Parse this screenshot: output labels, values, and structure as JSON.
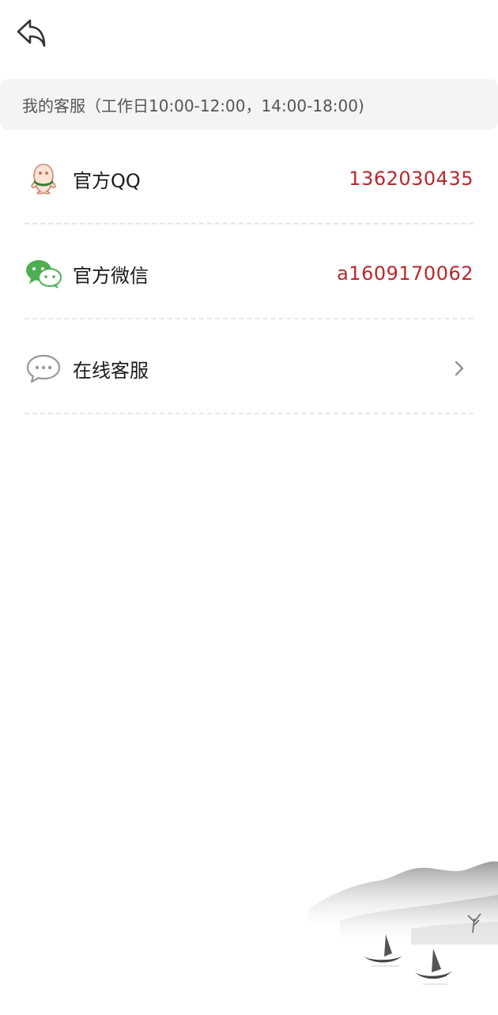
{
  "header": {
    "back_icon": "back-arrow-icon"
  },
  "banner": {
    "text": "我的客服（工作日10:00-12:00，14:00-18:00)"
  },
  "contacts": [
    {
      "icon": "qq-icon",
      "label": "官方QQ",
      "value": "1362030435"
    },
    {
      "icon": "wechat-icon",
      "label": "官方微信",
      "value": "a1609170062"
    },
    {
      "icon": "chat-bubble-icon",
      "label": "在线客服",
      "value": "",
      "chevron": "chevron-right-icon"
    }
  ],
  "decoration": {
    "illustration": "ink-landscape-boats"
  },
  "colors": {
    "accent": "#b8282e",
    "banner_bg": "#f4f4f4",
    "divider": "#e6e6e6"
  }
}
